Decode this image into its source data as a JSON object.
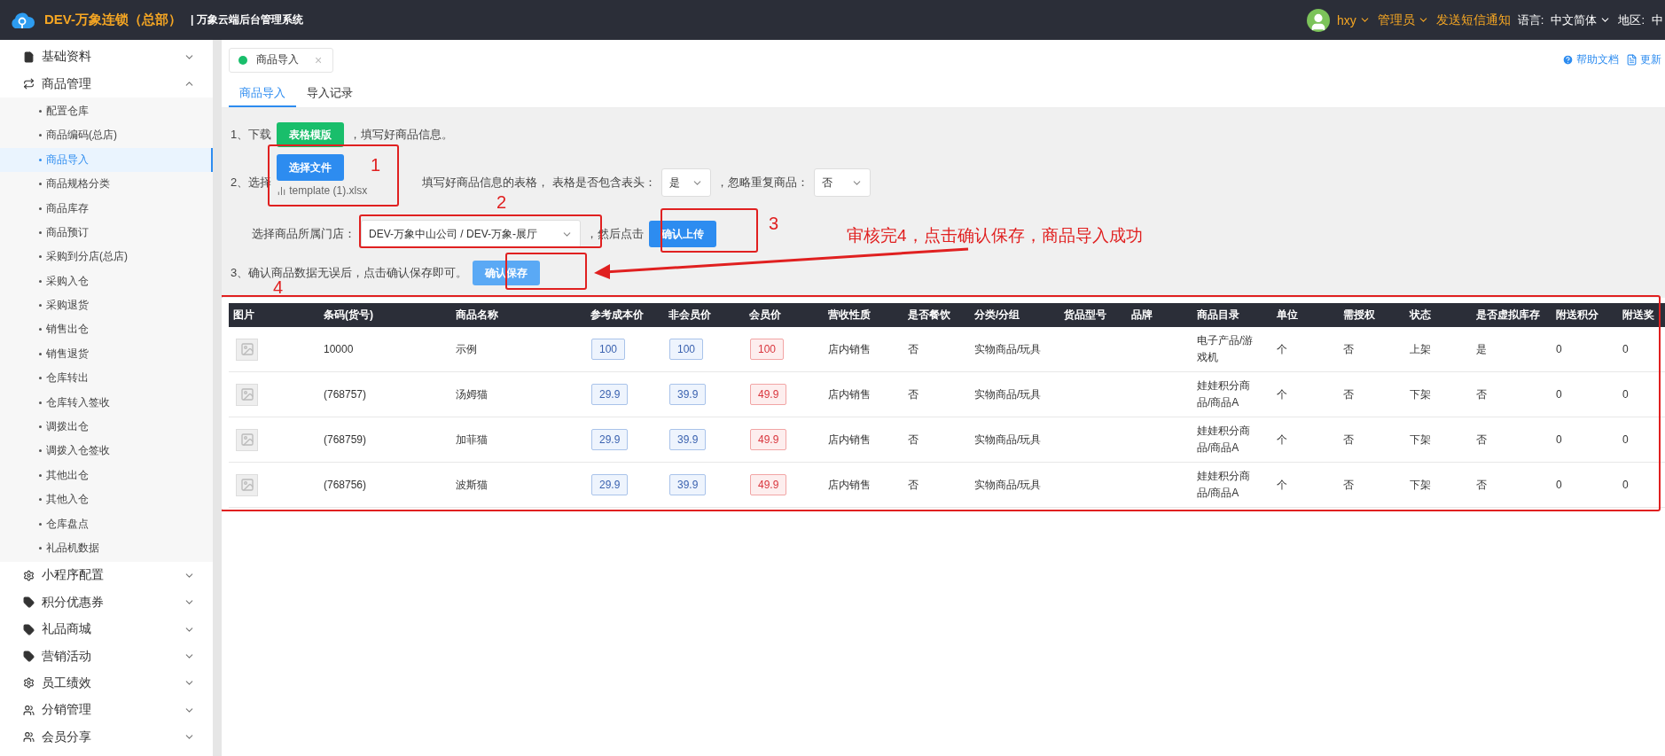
{
  "topbar": {
    "brand": "DEV-万象连锁（总部）",
    "system": "| 万象云端后台管理系统",
    "user": "hxy",
    "role": "管理员",
    "sms": "发送短信通知",
    "language_label": "语言:",
    "language": "中文简体",
    "region_label": "地区:",
    "region": "中"
  },
  "sidebar": {
    "items": [
      {
        "label": "基础资料",
        "kind": "document",
        "expanded": false
      },
      {
        "label": "商品管理",
        "kind": "transfer",
        "expanded": true,
        "children": [
          {
            "label": "配置仓库",
            "selected": false
          },
          {
            "label": "商品编码(总店)",
            "selected": false
          },
          {
            "label": "商品导入",
            "selected": true
          },
          {
            "label": "商品规格分类",
            "selected": false
          },
          {
            "label": "商品库存",
            "selected": false
          },
          {
            "label": "商品预订",
            "selected": false
          },
          {
            "label": "采购到分店(总店)",
            "selected": false
          },
          {
            "label": "采购入仓",
            "selected": false
          },
          {
            "label": "采购退货",
            "selected": false
          },
          {
            "label": "销售出仓",
            "selected": false
          },
          {
            "label": "销售退货",
            "selected": false
          },
          {
            "label": "仓库转出",
            "selected": false
          },
          {
            "label": "仓库转入签收",
            "selected": false
          },
          {
            "label": "调拨出仓",
            "selected": false
          },
          {
            "label": "调拨入仓签收",
            "selected": false
          },
          {
            "label": "其他出仓",
            "selected": false
          },
          {
            "label": "其他入仓",
            "selected": false
          },
          {
            "label": "仓库盘点",
            "selected": false
          },
          {
            "label": "礼品机数据",
            "selected": false
          }
        ]
      },
      {
        "label": "小程序配置",
        "kind": "settings",
        "expanded": false
      },
      {
        "label": "积分优惠券",
        "kind": "coupon",
        "expanded": false
      },
      {
        "label": "礼品商城",
        "kind": "coupon",
        "expanded": false
      },
      {
        "label": "营销活动",
        "kind": "coupon",
        "expanded": false
      },
      {
        "label": "员工绩效",
        "kind": "settings",
        "expanded": false
      },
      {
        "label": "分销管理",
        "kind": "people",
        "expanded": false
      },
      {
        "label": "会员分享",
        "kind": "people",
        "expanded": false
      }
    ]
  },
  "page_tab": {
    "label": "商品导入",
    "close": "×"
  },
  "help_links": [
    {
      "label": "帮助文档",
      "kind": "help"
    },
    {
      "label": "更新",
      "kind": "doc"
    }
  ],
  "tabs": [
    {
      "label": "商品导入",
      "selected": true
    },
    {
      "label": "导入记录",
      "selected": false
    }
  ],
  "steps": {
    "download": {
      "prefix": "1、下载",
      "button": "表格模版",
      "suffix": "，填写好商品信息。"
    },
    "select": {
      "prefix": "2、选择",
      "button": "选择文件",
      "file": "template (1).xlsx",
      "text": "填写好商品信息的表格， 表格是否包含表头：",
      "header_value": "是",
      "dup_label": "，忽略重复商品：",
      "dup_value": "否"
    },
    "store": {
      "label": "选择商品所属门店：",
      "value": "DEV-万象中山公司 / DEV-万象-展厅",
      "suffix": "，然后点击",
      "button": "确认上传"
    },
    "confirm": {
      "text": "3、确认商品数据无误后，点击确认保存即可。",
      "button": "确认保存"
    }
  },
  "table": {
    "columns": [
      {
        "label": "图片",
        "kind": "image"
      },
      {
        "label": "条码(货号)",
        "kind": "text"
      },
      {
        "label": "商品名称",
        "kind": "text"
      },
      {
        "label": "参考成本价",
        "kind": "price"
      },
      {
        "label": "非会员价",
        "kind": "price"
      },
      {
        "label": "会员价",
        "kind": "member-price"
      },
      {
        "label": "营收性质",
        "kind": "text"
      },
      {
        "label": "是否餐饮",
        "kind": "text"
      },
      {
        "label": "分类/分组",
        "kind": "text"
      },
      {
        "label": "货品型号",
        "kind": "text"
      },
      {
        "label": "品牌",
        "kind": "text"
      },
      {
        "label": "商品目录",
        "kind": "wrap"
      },
      {
        "label": "单位",
        "kind": "text"
      },
      {
        "label": "需授权",
        "kind": "text"
      },
      {
        "label": "状态",
        "kind": "text"
      },
      {
        "label": "是否虚拟库存",
        "kind": "text"
      },
      {
        "label": "附送积分",
        "kind": "text"
      },
      {
        "label": "附送奖",
        "kind": "text"
      }
    ],
    "rows": [
      [
        null,
        "10000",
        "示例",
        "100",
        "100",
        "100",
        "店内销售",
        "否",
        "实物商品/玩具",
        null,
        null,
        "电子产品/游戏机",
        "个",
        "否",
        "上架",
        "是",
        "0",
        "0"
      ],
      [
        null,
        "(768757)",
        "汤姆猫",
        "29.9",
        "39.9",
        "49.9",
        "店内销售",
        "否",
        "实物商品/玩具",
        null,
        null,
        "娃娃积分商品/商品A",
        "个",
        "否",
        "下架",
        "否",
        "0",
        "0"
      ],
      [
        null,
        "(768759)",
        "加菲猫",
        "29.9",
        "39.9",
        "49.9",
        "店内销售",
        "否",
        "实物商品/玩具",
        null,
        null,
        "娃娃积分商品/商品A",
        "个",
        "否",
        "下架",
        "否",
        "0",
        "0"
      ],
      [
        null,
        "(768756)",
        "波斯猫",
        "29.9",
        "39.9",
        "49.9",
        "店内销售",
        "否",
        "实物商品/玩具",
        null,
        null,
        "娃娃积分商品/商品A",
        "个",
        "否",
        "下架",
        "否",
        "0",
        "0"
      ]
    ]
  },
  "annotations": {
    "labels": [
      "1",
      "2",
      "3",
      "4"
    ],
    "note": "审核完4，点击确认保存，商品导入成功"
  }
}
